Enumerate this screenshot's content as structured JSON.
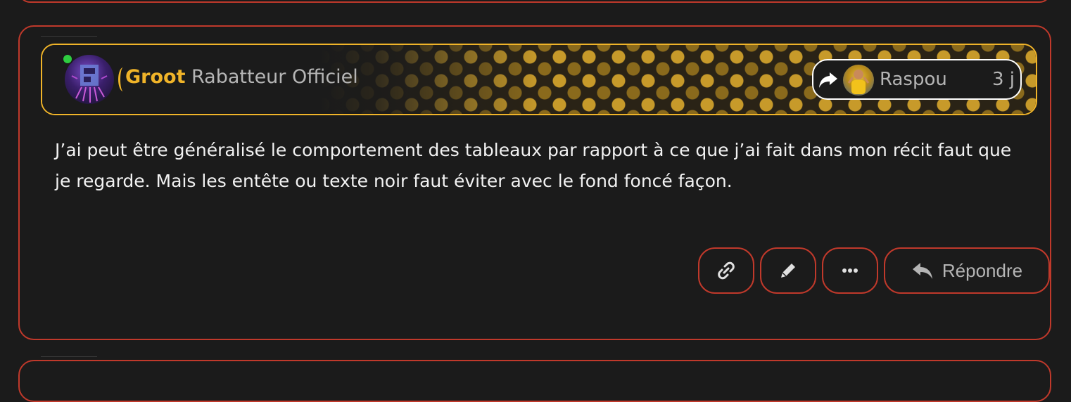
{
  "post": {
    "author": {
      "username": "Groot",
      "title": "Rabatteur Officiel",
      "status": "online"
    },
    "reply_to": {
      "username": "Raspou",
      "time": "3 j"
    },
    "body": "J’ai peut être généralisé le comportement des tableaux par rapport à ce que j’ai fait dans mon récit faut que je regarde. Mais les entête ou texte noir faut éviter avec le fond foncé façon.",
    "actions": {
      "link_icon": "link-icon",
      "edit_icon": "pencil-icon",
      "more_icon": "ellipsis-icon",
      "reply_label": "Répondre"
    }
  },
  "colors": {
    "background": "#1b1b1b",
    "post_border": "#c0392b",
    "banner_border": "#f0b429",
    "username": "#f0b429",
    "usertitle": "#b5b5b5",
    "text": "#f2f2f2",
    "online": "#2ecc40"
  }
}
